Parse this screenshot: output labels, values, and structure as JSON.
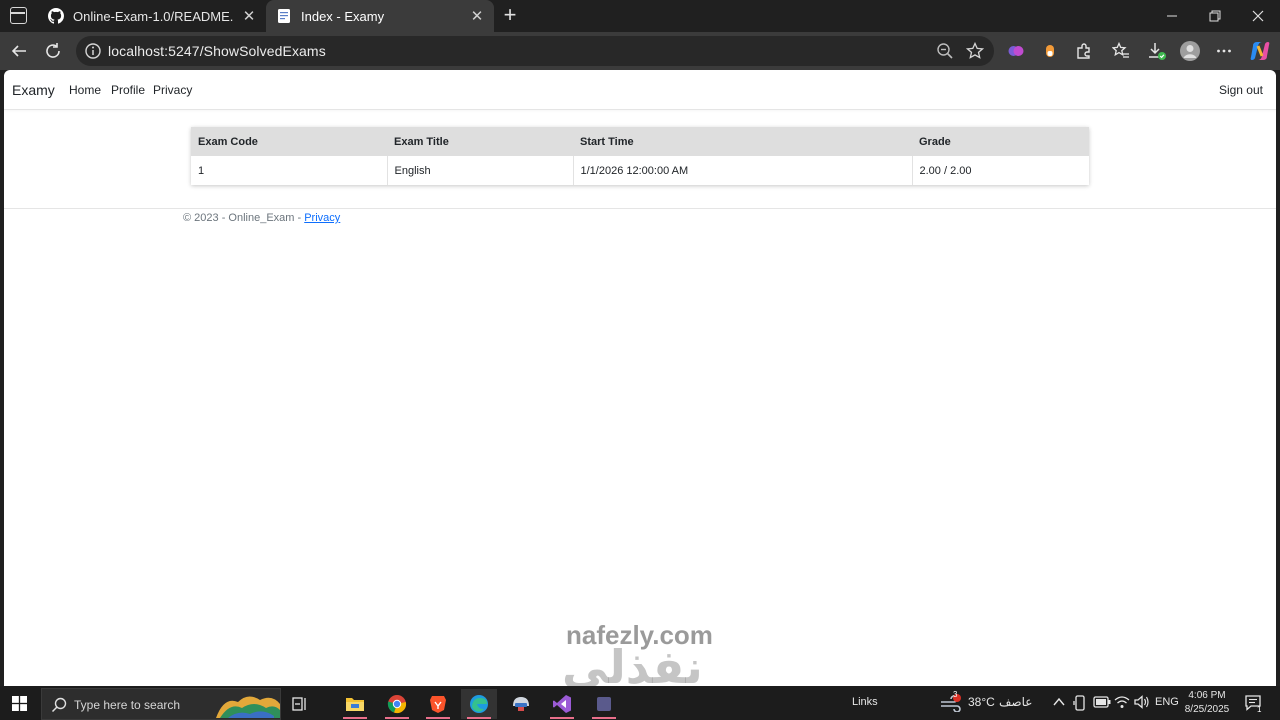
{
  "browser": {
    "tabs": [
      {
        "title": "Online-Exam-1.0/README.md at",
        "active": false,
        "icon": "github-icon"
      },
      {
        "title": "Index - Examy",
        "active": true,
        "icon": "page-icon"
      }
    ],
    "url": "localhost:5247/ShowSolvedExams"
  },
  "navbar": {
    "brand": "Examy",
    "links": [
      "Home",
      "Profile",
      "Privacy"
    ],
    "signout": "Sign out"
  },
  "table": {
    "headers": [
      "Exam Code",
      "Exam Title",
      "Start Time",
      "Grade"
    ],
    "rows": [
      [
        "1",
        "English",
        "1/1/2026 12:00:00 AM",
        "2.00 / 2.00"
      ]
    ]
  },
  "footer": {
    "text": "© 2023 - Online_Exam - ",
    "link": "Privacy"
  },
  "watermark": {
    "arabic": "نفذلي",
    "latin": "nafezly.com"
  },
  "taskbar": {
    "search_placeholder": "Type here to search",
    "links_label": "Links",
    "weather_temp": "38°C",
    "weather_desc": "عاصف",
    "weather_badge": "3",
    "language": "ENG",
    "time": "4:06 PM",
    "date": "8/25/2025",
    "notification_count": "1"
  },
  "colors": {
    "accent": "#0d6efd",
    "table_header_bg": "#dedede",
    "chrome_bg": "#202020",
    "toolbar_bg": "#3b3b3b"
  }
}
